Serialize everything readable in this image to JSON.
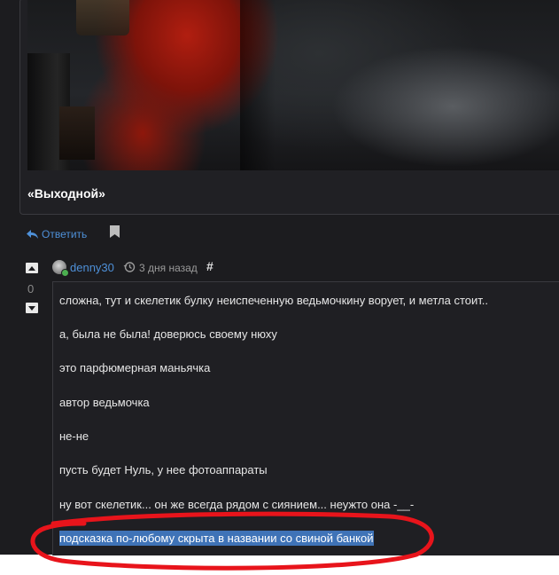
{
  "post": {
    "caption": "«Выходной»"
  },
  "actions": {
    "reply_label": "Ответить"
  },
  "comment": {
    "vote_count": "0",
    "username": "denny30",
    "timestamp": "3 дня назад",
    "permalink": "#",
    "lines": [
      "сложна, тут и скелетик булку неиспеченную ведьмочкину ворует, и метла стоит..",
      "а, была не была! доверюсь своему нюху",
      "это парфюмерная маньячка",
      "автор ведьмочка",
      "не-не",
      "пусть будет Нуль, у нее фотоаппараты",
      "ну вот скелетик... он же всегда рядом с сиянием... неужто она -__-",
      "подсказка по-любому скрыта в названии со свиной банкой"
    ]
  },
  "colors": {
    "background": "#1c1c1f",
    "link": "#4e90d8",
    "selection": "#3f73b7",
    "annotation": "#e8141b"
  }
}
